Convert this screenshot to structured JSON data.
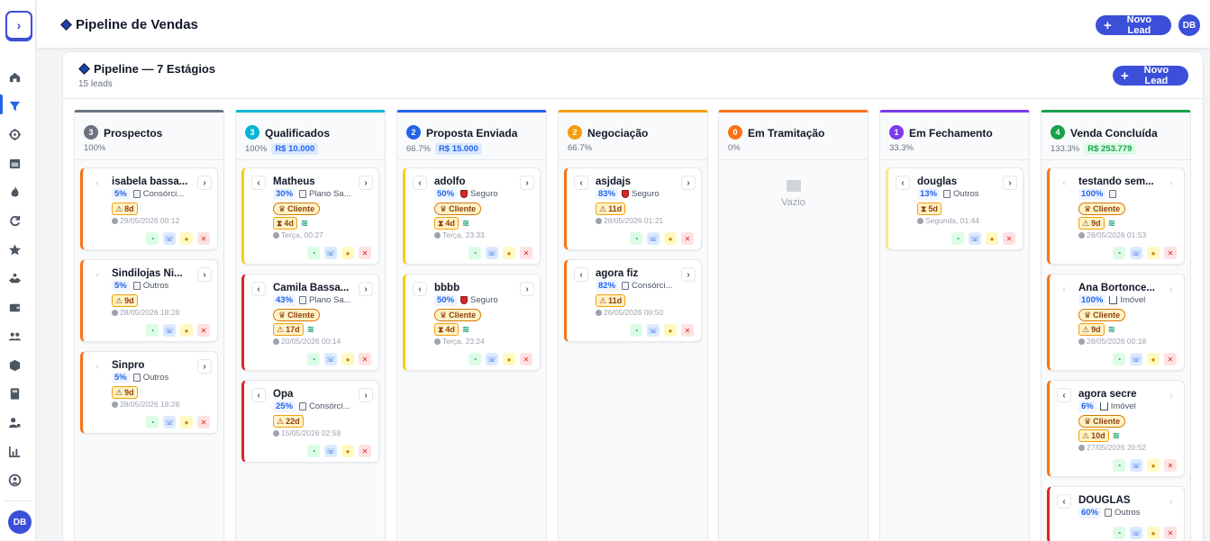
{
  "app": {
    "title": "Pipeline de Vendas",
    "new_lead_label": "Novo Lead",
    "user_initials": "DB",
    "colors": {
      "primary": "#3b4fd8",
      "success": "#16a34a",
      "danger": "#dc2626"
    }
  },
  "sidebar": {
    "items": [
      {
        "icon": "home-icon"
      },
      {
        "icon": "filter-icon"
      },
      {
        "icon": "target-icon"
      },
      {
        "icon": "calendar-icon"
      },
      {
        "icon": "flame-icon"
      },
      {
        "icon": "refresh-icon"
      },
      {
        "icon": "star-icon"
      },
      {
        "icon": "handshake-icon"
      },
      {
        "icon": "wallet-icon"
      },
      {
        "icon": "users-icon"
      },
      {
        "icon": "box-icon"
      },
      {
        "icon": "calculator-icon"
      },
      {
        "icon": "user-settings-icon"
      },
      {
        "icon": "chart-icon"
      },
      {
        "icon": "user-circle-icon"
      }
    ]
  },
  "panel": {
    "title": "Pipeline — 7 Estágios",
    "subtitle": "15 leads",
    "new_lead_label": "Novo Lead"
  },
  "labels": {
    "cliente": "Cliente",
    "empty": "Vazio"
  },
  "columns": [
    {
      "num": "3",
      "title": "Prospectos",
      "percent": "100%",
      "value": "",
      "color": "#6b7280",
      "cards": [
        {
          "name": "isabela bassa...",
          "pct": "5%",
          "product": "Consórci...",
          "product_icon": "building-icon",
          "cliente": false,
          "days": "8d",
          "money": false,
          "date": "29/05/2026 00:12",
          "border": "#f97316",
          "prev": false
        },
        {
          "name": "Sindilojas Ni...",
          "pct": "5%",
          "product": "Outros",
          "product_icon": "document-icon",
          "cliente": false,
          "days": "9d",
          "money": false,
          "date": "28/05/2026 18:28",
          "border": "#f97316",
          "prev": false
        },
        {
          "name": "Sinpro",
          "pct": "5%",
          "product": "Outros",
          "product_icon": "document-icon",
          "cliente": false,
          "days": "9d",
          "money": false,
          "date": "28/05/2026 18:28",
          "border": "#f97316",
          "prev": false
        }
      ]
    },
    {
      "num": "3",
      "title": "Qualificados",
      "percent": "100%",
      "value": "R$ 10.000",
      "value_style": "blue",
      "color": "#06b6d4",
      "cards": [
        {
          "name": "Matheus",
          "pct": "30%",
          "product": "Plano Sa...",
          "product_icon": "building-icon",
          "cliente": true,
          "days": "4d",
          "hourglass": true,
          "money": true,
          "date": "Terça, 00:27",
          "border": "#facc15",
          "prev": true
        },
        {
          "name": "Camila Bassa...",
          "pct": "43%",
          "product": "Plano Sa...",
          "product_icon": "building-icon",
          "cliente": true,
          "days": "17d",
          "money": true,
          "date": "20/05/2026 00:14",
          "border": "#dc2626",
          "prev": true
        },
        {
          "name": "Opa",
          "pct": "25%",
          "product": "Consórci...",
          "product_icon": "building-icon",
          "cliente": false,
          "days": "22d",
          "money": false,
          "date": "15/05/2026 02:58",
          "border": "#dc2626",
          "prev": true
        }
      ]
    },
    {
      "num": "2",
      "title": "Proposta Enviada",
      "percent": "66.7%",
      "value": "R$ 15.000",
      "value_style": "blue",
      "color": "#2563eb",
      "cards": [
        {
          "name": "adolfo",
          "pct": "50%",
          "product": "Seguro",
          "product_icon": "shield-icon",
          "cliente": true,
          "days": "4d",
          "hourglass": true,
          "money": true,
          "date": "Terça, 23:33",
          "border": "#facc15",
          "prev": true
        },
        {
          "name": "bbbb",
          "pct": "50%",
          "product": "Seguro",
          "product_icon": "shield-icon",
          "cliente": true,
          "days": "4d",
          "hourglass": true,
          "money": true,
          "date": "Terça, 23:24",
          "border": "#facc15",
          "prev": true
        }
      ]
    },
    {
      "num": "2",
      "title": "Negociação",
      "percent": "66.7%",
      "value": "",
      "color": "#f59e0b",
      "cards": [
        {
          "name": "asjdajs",
          "pct": "83%",
          "product": "Seguro",
          "product_icon": "shield-icon",
          "cliente": false,
          "days": "11d",
          "money": false,
          "date": "28/05/2026 01:21",
          "border": "#f97316",
          "prev": true
        },
        {
          "name": "agora fiz",
          "pct": "82%",
          "product": "Consórci...",
          "product_icon": "building-icon",
          "cliente": false,
          "days": "11d",
          "money": false,
          "date": "26/05/2026 00:50",
          "border": "#f97316",
          "prev": true
        }
      ]
    },
    {
      "num": "0",
      "title": "Em Tramitação",
      "percent": "0%",
      "value": "",
      "color": "#f97316",
      "cards": []
    },
    {
      "num": "1",
      "title": "Em Fechamento",
      "percent": "33.3%",
      "value": "",
      "color": "#7c3aed",
      "cards": [
        {
          "name": "douglas",
          "pct": "13%",
          "product": "Outros",
          "product_icon": "document-icon",
          "cliente": false,
          "days": "5d",
          "hourglass": true,
          "money": false,
          "date": "Segunda, 01:44",
          "border": "#fde68a",
          "prev": true
        }
      ]
    },
    {
      "num": "4",
      "title": "Venda Concluída",
      "percent": "133.3%",
      "value": "R$ 253.779",
      "value_style": "green",
      "color": "#16a34a",
      "cards": [
        {
          "name": "testando sem...",
          "pct": "100%",
          "product": "",
          "product_icon": "document-icon",
          "cliente": true,
          "days": "9d",
          "money": true,
          "date": "28/05/2026 01:53",
          "border": "#f97316",
          "prev": false
        },
        {
          "name": "Ana Bortonce...",
          "pct": "100%",
          "product": "Imóvel",
          "product_icon": "house-icon",
          "cliente": true,
          "days": "9d",
          "money": true,
          "date": "28/05/2026 00:18",
          "border": "#f97316",
          "prev": false
        },
        {
          "name": "agora secre",
          "pct": "6%",
          "product": "Imóvel",
          "product_icon": "house-icon",
          "cliente": true,
          "days": "10d",
          "money": true,
          "date": "27/05/2026 20:52",
          "border": "#f97316",
          "prev": true
        },
        {
          "name": "DOUGLAS",
          "pct": "60%",
          "product": "Outros",
          "product_icon": "document-icon",
          "cliente": false,
          "days": "",
          "money": false,
          "date": "",
          "border": "#dc2626",
          "prev": true
        }
      ]
    }
  ]
}
